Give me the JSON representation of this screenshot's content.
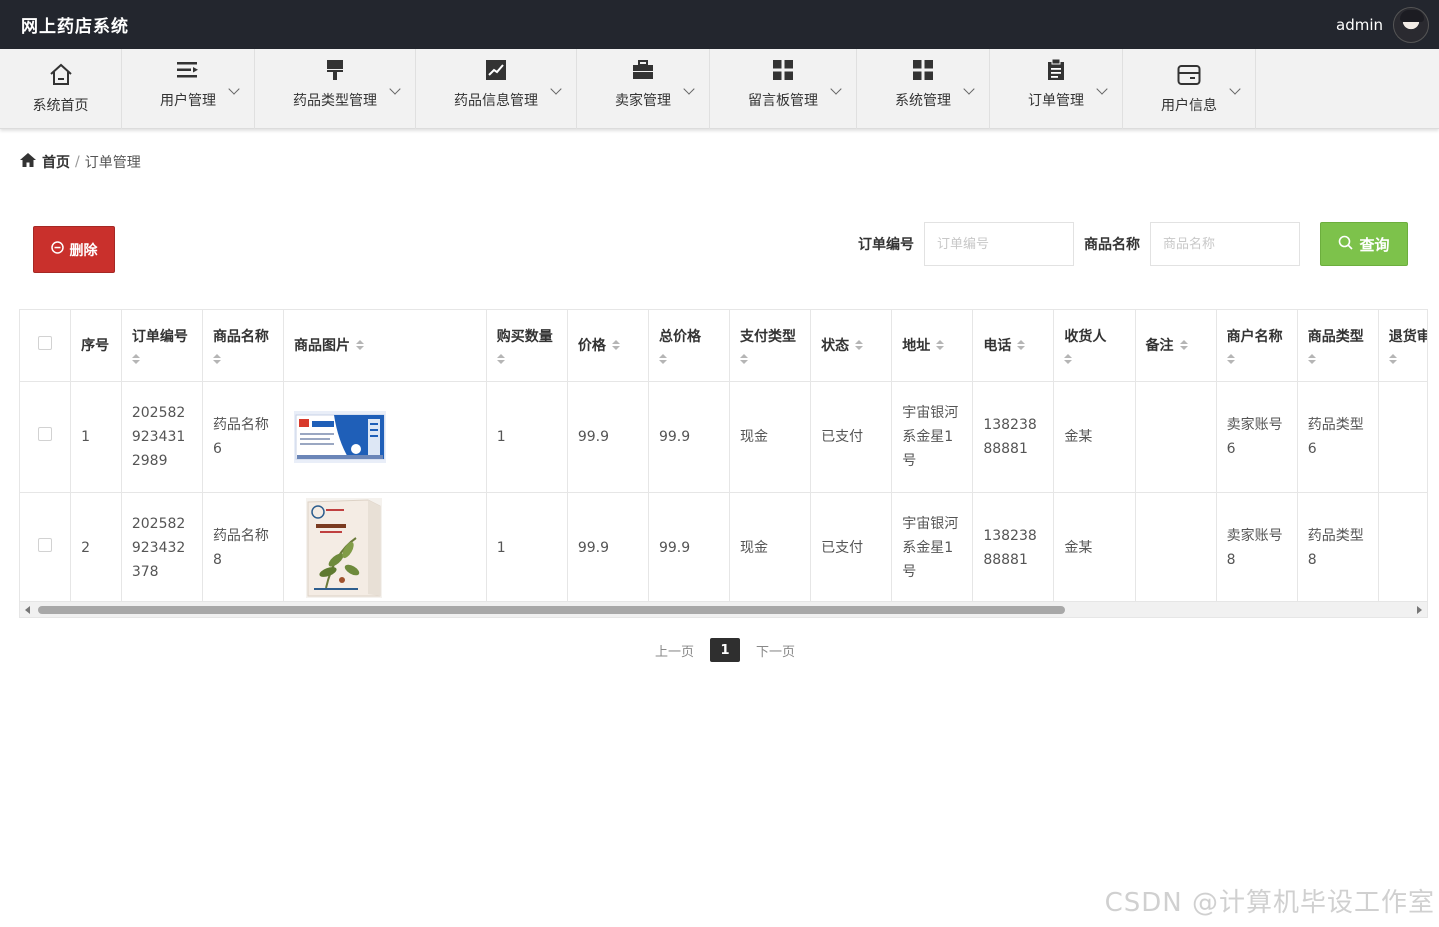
{
  "header": {
    "app_title": "网上药店系统",
    "username": "admin"
  },
  "nav": {
    "items": [
      {
        "label": "系统首页",
        "icon": "home-icon",
        "dropdown": false
      },
      {
        "label": "用户管理",
        "icon": "list-icon",
        "dropdown": true
      },
      {
        "label": "药品类型管理",
        "icon": "brush-icon",
        "dropdown": true
      },
      {
        "label": "药品信息管理",
        "icon": "chart-icon",
        "dropdown": true
      },
      {
        "label": "卖家管理",
        "icon": "briefcase-icon",
        "dropdown": true
      },
      {
        "label": "留言板管理",
        "icon": "grid-icon",
        "dropdown": true
      },
      {
        "label": "系统管理",
        "icon": "grid-icon",
        "dropdown": true
      },
      {
        "label": "订单管理",
        "icon": "clipboard-icon",
        "dropdown": true
      },
      {
        "label": "用户信息",
        "icon": "card-icon",
        "dropdown": true
      }
    ]
  },
  "breadcrumb": {
    "home": "首页",
    "separator": "/",
    "current": "订单管理"
  },
  "toolbar": {
    "delete_label": "删除",
    "search": [
      {
        "label": "订单编号",
        "placeholder": "订单编号",
        "value": ""
      },
      {
        "label": "商品名称",
        "placeholder": "商品名称",
        "value": ""
      }
    ],
    "query_label": "查询"
  },
  "table": {
    "columns": [
      "序号",
      "订单编号",
      "商品名称",
      "商品图片",
      "购买数量",
      "价格",
      "总价格",
      "支付类型",
      "状态",
      "地址",
      "电话",
      "收货人",
      "备注",
      "商户名称",
      "商品类型",
      "退货审核"
    ],
    "rows": [
      {
        "index": "1",
        "order_no": "2025829234312989",
        "product_name": "药品名称6",
        "image": "drug-box-blue",
        "quantity": "1",
        "price": "99.9",
        "total": "99.9",
        "pay_type": "现金",
        "status": "已支付",
        "address": "宇宙银河系金星1号",
        "phone": "13823888881",
        "receiver": "金某",
        "remark": "",
        "merchant": "卖家账号6",
        "category": "药品类型6",
        "return_review": ""
      },
      {
        "index": "2",
        "order_no": "202582923432378",
        "product_name": "药品名称8",
        "image": "drug-box-herbal",
        "quantity": "1",
        "price": "99.9",
        "total": "99.9",
        "pay_type": "现金",
        "status": "已支付",
        "address": "宇宙银河系金星1号",
        "phone": "13823888881",
        "receiver": "金某",
        "remark": "",
        "merchant": "卖家账号8",
        "category": "药品类型8",
        "return_review": ""
      }
    ]
  },
  "pagination": {
    "prev": "上一页",
    "current": "1",
    "next": "下一页"
  },
  "watermark": "CSDN @计算机毕设工作室",
  "colors": {
    "topbar": "#23262e",
    "delete": "#c9302c",
    "query": "#7dc24b",
    "page_current": "#2f2f2f"
  }
}
